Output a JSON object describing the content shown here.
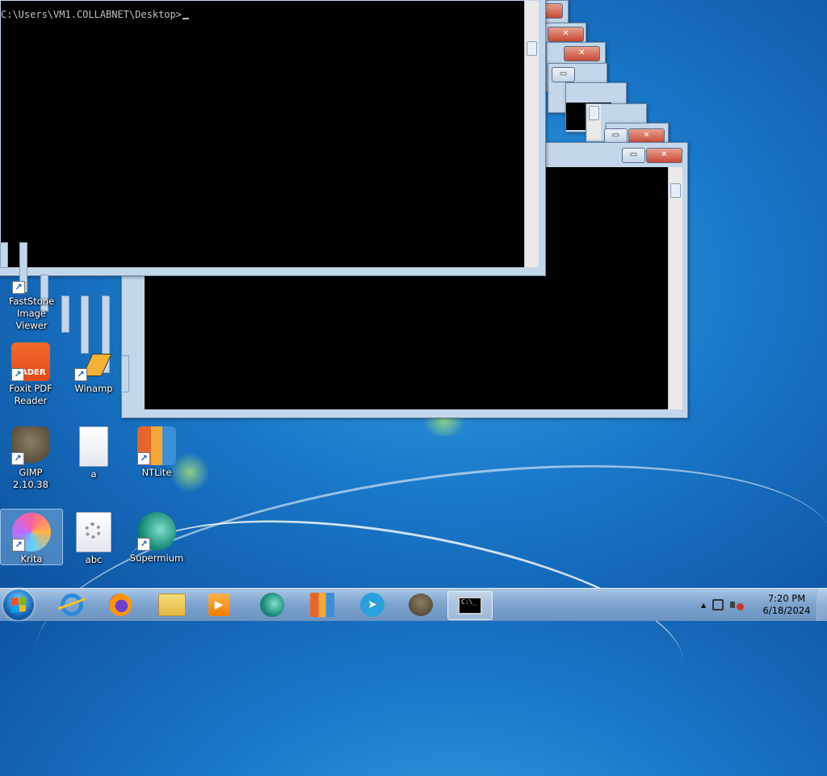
{
  "console": {
    "prompt": "C:\\Users\\VM1.COLLABNET\\Desktop>",
    "minimize_label": "▭",
    "close_label": "✕"
  },
  "desktop_icons": [
    {
      "label": "FastStone Image Viewer",
      "icon": "faststone-icon"
    },
    {
      "label": "Foxit PDF Reader",
      "icon": "foxit-pdf-icon",
      "badge": "ADER"
    },
    {
      "label": "Winamp",
      "icon": "winamp-icon"
    },
    {
      "label": "GIMP 2.10.38",
      "icon": "gimp-icon"
    },
    {
      "label": "a",
      "icon": "text-file-icon"
    },
    {
      "label": "NTLite",
      "icon": "ntlite-icon"
    },
    {
      "label": "Krita",
      "icon": "krita-icon"
    },
    {
      "label": "abc",
      "icon": "settings-file-icon"
    },
    {
      "label": "Supermium",
      "icon": "supermium-icon"
    }
  ],
  "taskbar": {
    "pinned": [
      {
        "name": "internet-explorer",
        "icon": "internet-explorer-icon"
      },
      {
        "name": "firefox",
        "icon": "firefox-icon"
      },
      {
        "name": "file-explorer",
        "icon": "folder-icon"
      },
      {
        "name": "media-player",
        "icon": "media-player-icon"
      },
      {
        "name": "supermium",
        "icon": "supermium-icon"
      },
      {
        "name": "ntlite",
        "icon": "ntlite-icon"
      },
      {
        "name": "telegram",
        "icon": "telegram-icon"
      },
      {
        "name": "gimp",
        "icon": "gimp-icon"
      },
      {
        "name": "command-prompt",
        "icon": "cmd-icon",
        "active": true
      }
    ],
    "cmd_icon_text": "C:\\_",
    "tray_arrow": "▲",
    "clock_time": "7:20 PM",
    "clock_date": "6/18/2024"
  },
  "colors": {
    "desktop": "#1a78c9",
    "console_bg": "#000000",
    "window_frame": "#c4d7ea",
    "close_button": "#c74b36"
  }
}
